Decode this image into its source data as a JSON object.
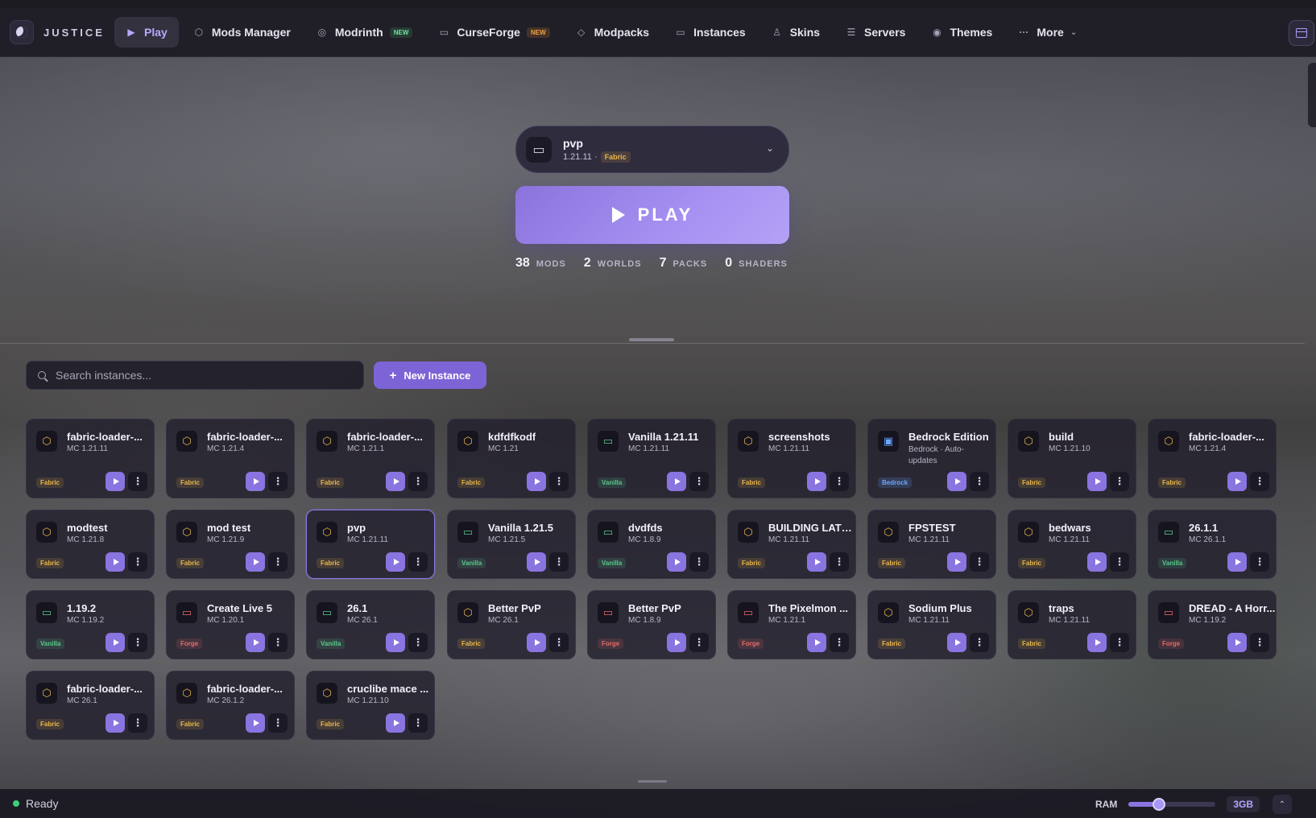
{
  "app": {
    "brand": "JUSTICE",
    "nav": [
      {
        "label": "Play",
        "icon": "play-icon",
        "active": true
      },
      {
        "label": "Mods Manager",
        "icon": "hexagon-icon"
      },
      {
        "label": "Modrinth",
        "icon": "modrinth-icon",
        "badge": "NEW"
      },
      {
        "label": "CurseForge",
        "icon": "curseforge-icon",
        "badge": "NEW"
      },
      {
        "label": "Modpacks",
        "icon": "cube-icon"
      },
      {
        "label": "Instances",
        "icon": "monitor-icon"
      },
      {
        "label": "Skins",
        "icon": "person-icon"
      },
      {
        "label": "Servers",
        "icon": "server-icon"
      },
      {
        "label": "Themes",
        "icon": "palette-icon"
      },
      {
        "label": "More",
        "icon": "dots-icon"
      }
    ]
  },
  "hero": {
    "selected_name": "pvp",
    "selected_version": "1.21.11 ·",
    "selected_loader": "Fabric",
    "play_label": "PLAY",
    "stats": [
      {
        "num": "38",
        "label": "MODS"
      },
      {
        "num": "2",
        "label": "WORLDS"
      },
      {
        "num": "7",
        "label": "PACKS"
      },
      {
        "num": "0",
        "label": "SHADERS"
      }
    ]
  },
  "search": {
    "placeholder": "Search instances..."
  },
  "new_instance_label": "New Instance",
  "instances": [
    {
      "name": "fabric-loader-...",
      "ver": "MC 1.21.11",
      "loader": "Fabric"
    },
    {
      "name": "fabric-loader-...",
      "ver": "MC 1.21.4",
      "loader": "Fabric"
    },
    {
      "name": "fabric-loader-...",
      "ver": "MC 1.21.1",
      "loader": "Fabric"
    },
    {
      "name": "kdfdfkodf",
      "ver": "MC 1.21",
      "loader": "Fabric"
    },
    {
      "name": "Vanilla 1.21.11",
      "ver": "MC 1.21.11",
      "loader": "Vanilla"
    },
    {
      "name": "screenshots",
      "ver": "MC 1.21.11",
      "loader": "Fabric"
    },
    {
      "name": "Bedrock Edition",
      "ver": "Bedrock · Auto-updates",
      "loader": "Bedrock"
    },
    {
      "name": "build",
      "ver": "MC 1.21.10",
      "loader": "Fabric"
    },
    {
      "name": "fabric-loader-...",
      "ver": "MC 1.21.4",
      "loader": "Fabric"
    },
    {
      "name": "modtest",
      "ver": "MC 1.21.8",
      "loader": "Fabric"
    },
    {
      "name": "mod test",
      "ver": "MC 1.21.9",
      "loader": "Fabric"
    },
    {
      "name": "pvp",
      "ver": "MC 1.21.11",
      "loader": "Fabric",
      "selected": true
    },
    {
      "name": "Vanilla 1.21.5",
      "ver": "MC 1.21.5",
      "loader": "Vanilla"
    },
    {
      "name": "dvdfds",
      "ver": "MC 1.8.9",
      "loader": "Vanilla"
    },
    {
      "name": "BUILDING LATEST",
      "ver": "MC 1.21.11",
      "loader": "Fabric"
    },
    {
      "name": "FPSTEST",
      "ver": "MC 1.21.11",
      "loader": "Fabric"
    },
    {
      "name": "bedwars",
      "ver": "MC 1.21.11",
      "loader": "Fabric"
    },
    {
      "name": "26.1.1",
      "ver": "MC 26.1.1",
      "loader": "Vanilla"
    },
    {
      "name": "1.19.2",
      "ver": "MC 1.19.2",
      "loader": "Vanilla"
    },
    {
      "name": "Create Live 5",
      "ver": "MC 1.20.1",
      "loader": "Forge"
    },
    {
      "name": "26.1",
      "ver": "MC 26.1",
      "loader": "Vanilla"
    },
    {
      "name": "Better PvP",
      "ver": "MC 26.1",
      "loader": "Fabric"
    },
    {
      "name": "Better PvP",
      "ver": "MC 1.8.9",
      "loader": "Forge"
    },
    {
      "name": "The Pixelmon ...",
      "ver": "MC 1.21.1",
      "loader": "Forge"
    },
    {
      "name": "Sodium Plus",
      "ver": "MC 1.21.11",
      "loader": "Fabric"
    },
    {
      "name": "traps",
      "ver": "MC 1.21.11",
      "loader": "Fabric"
    },
    {
      "name": "DREAD - A Horr...",
      "ver": "MC 1.19.2",
      "loader": "Forge"
    },
    {
      "name": "fabric-loader-...",
      "ver": "MC 26.1",
      "loader": "Fabric"
    },
    {
      "name": "fabric-loader-...",
      "ver": "MC 26.1.2",
      "loader": "Fabric"
    },
    {
      "name": "cruclibe mace ...",
      "ver": "MC 1.21.10",
      "loader": "Fabric"
    }
  ],
  "status": {
    "text": "Ready",
    "ram_label": "RAM",
    "ram_value": "3GB",
    "ram_fraction": 0.35
  },
  "colors": {
    "accent": "#8a74e0",
    "fabric": "#e8b64a",
    "vanilla": "#57c98a",
    "forge": "#e36a6a",
    "bedrock": "#6aa8ff"
  }
}
